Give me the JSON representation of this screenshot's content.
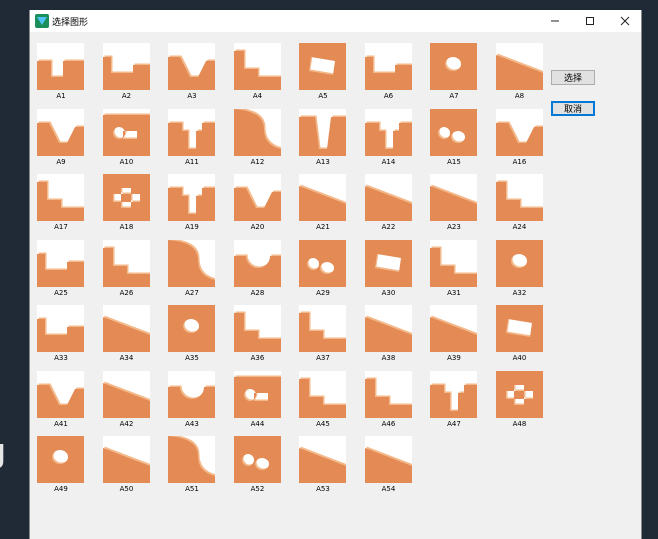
{
  "window": {
    "title": "选择图形",
    "select_label": "选择",
    "cancel_label": "取消",
    "minimize_icon": "minimize-icon",
    "maximize_icon": "maximize-icon",
    "close_icon": "close-icon"
  },
  "background_glyph": "J",
  "colors": {
    "shape_face": "#e38a55",
    "shape_edge": "#f4b98a",
    "shape_dark": "#c86a38",
    "accent": "#0078d7"
  },
  "items": [
    {
      "label": "A1",
      "icon": "slot-block-shape"
    },
    {
      "label": "A2",
      "icon": "notched-block-shape"
    },
    {
      "label": "A3",
      "icon": "v-notch-shape"
    },
    {
      "label": "A4",
      "icon": "stepped-block-shape"
    },
    {
      "label": "A5",
      "icon": "rect-hole-shape"
    },
    {
      "label": "A6",
      "icon": "notched-block-shape"
    },
    {
      "label": "A7",
      "icon": "round-hole-shape"
    },
    {
      "label": "A8",
      "icon": "slope-shape"
    },
    {
      "label": "A9",
      "icon": "v-notch-shape"
    },
    {
      "label": "A10",
      "icon": "keyhole-shape"
    },
    {
      "label": "A11",
      "icon": "t-slot-shape"
    },
    {
      "label": "A12",
      "icon": "curved-shape"
    },
    {
      "label": "A13",
      "icon": "trapezoid-slot-shape"
    },
    {
      "label": "A14",
      "icon": "t-slot-shape"
    },
    {
      "label": "A15",
      "icon": "double-hole-shape"
    },
    {
      "label": "A16",
      "icon": "v-notch-shape"
    },
    {
      "label": "A17",
      "icon": "stepped-block-shape"
    },
    {
      "label": "A18",
      "icon": "cross-hole-shape"
    },
    {
      "label": "A19",
      "icon": "t-slot-shape"
    },
    {
      "label": "A20",
      "icon": "v-notch-shape"
    },
    {
      "label": "A21",
      "icon": "slope-shape"
    },
    {
      "label": "A22",
      "icon": "slope-shape"
    },
    {
      "label": "A23",
      "icon": "slope-shape"
    },
    {
      "label": "A24",
      "icon": "stepped-block-shape"
    },
    {
      "label": "A25",
      "icon": "notched-block-shape"
    },
    {
      "label": "A26",
      "icon": "stepped-block-shape"
    },
    {
      "label": "A27",
      "icon": "curved-shape"
    },
    {
      "label": "A28",
      "icon": "round-notch-shape"
    },
    {
      "label": "A29",
      "icon": "double-hole-shape"
    },
    {
      "label": "A30",
      "icon": "rect-hole-shape"
    },
    {
      "label": "A31",
      "icon": "stepped-block-shape"
    },
    {
      "label": "A32",
      "icon": "round-hole-shape"
    },
    {
      "label": "A33",
      "icon": "notched-block-shape"
    },
    {
      "label": "A34",
      "icon": "slope-shape"
    },
    {
      "label": "A35",
      "icon": "round-hole-shape"
    },
    {
      "label": "A36",
      "icon": "stepped-block-shape"
    },
    {
      "label": "A37",
      "icon": "stepped-block-shape"
    },
    {
      "label": "A38",
      "icon": "slope-shape"
    },
    {
      "label": "A39",
      "icon": "slope-shape"
    },
    {
      "label": "A40",
      "icon": "rect-hole-shape"
    },
    {
      "label": "A41",
      "icon": "v-notch-shape"
    },
    {
      "label": "A42",
      "icon": "slope-shape"
    },
    {
      "label": "A43",
      "icon": "round-notch-shape"
    },
    {
      "label": "A44",
      "icon": "keyhole-shape"
    },
    {
      "label": "A45",
      "icon": "stepped-block-shape"
    },
    {
      "label": "A46",
      "icon": "stepped-block-shape"
    },
    {
      "label": "A47",
      "icon": "t-slot-shape"
    },
    {
      "label": "A48",
      "icon": "cross-hole-shape"
    },
    {
      "label": "A49",
      "icon": "round-hole-shape"
    },
    {
      "label": "A50",
      "icon": "slope-shape"
    },
    {
      "label": "A51",
      "icon": "curved-shape"
    },
    {
      "label": "A52",
      "icon": "double-hole-shape"
    },
    {
      "label": "A53",
      "icon": "slope-shape"
    },
    {
      "label": "A54",
      "icon": "slope-shape"
    }
  ]
}
